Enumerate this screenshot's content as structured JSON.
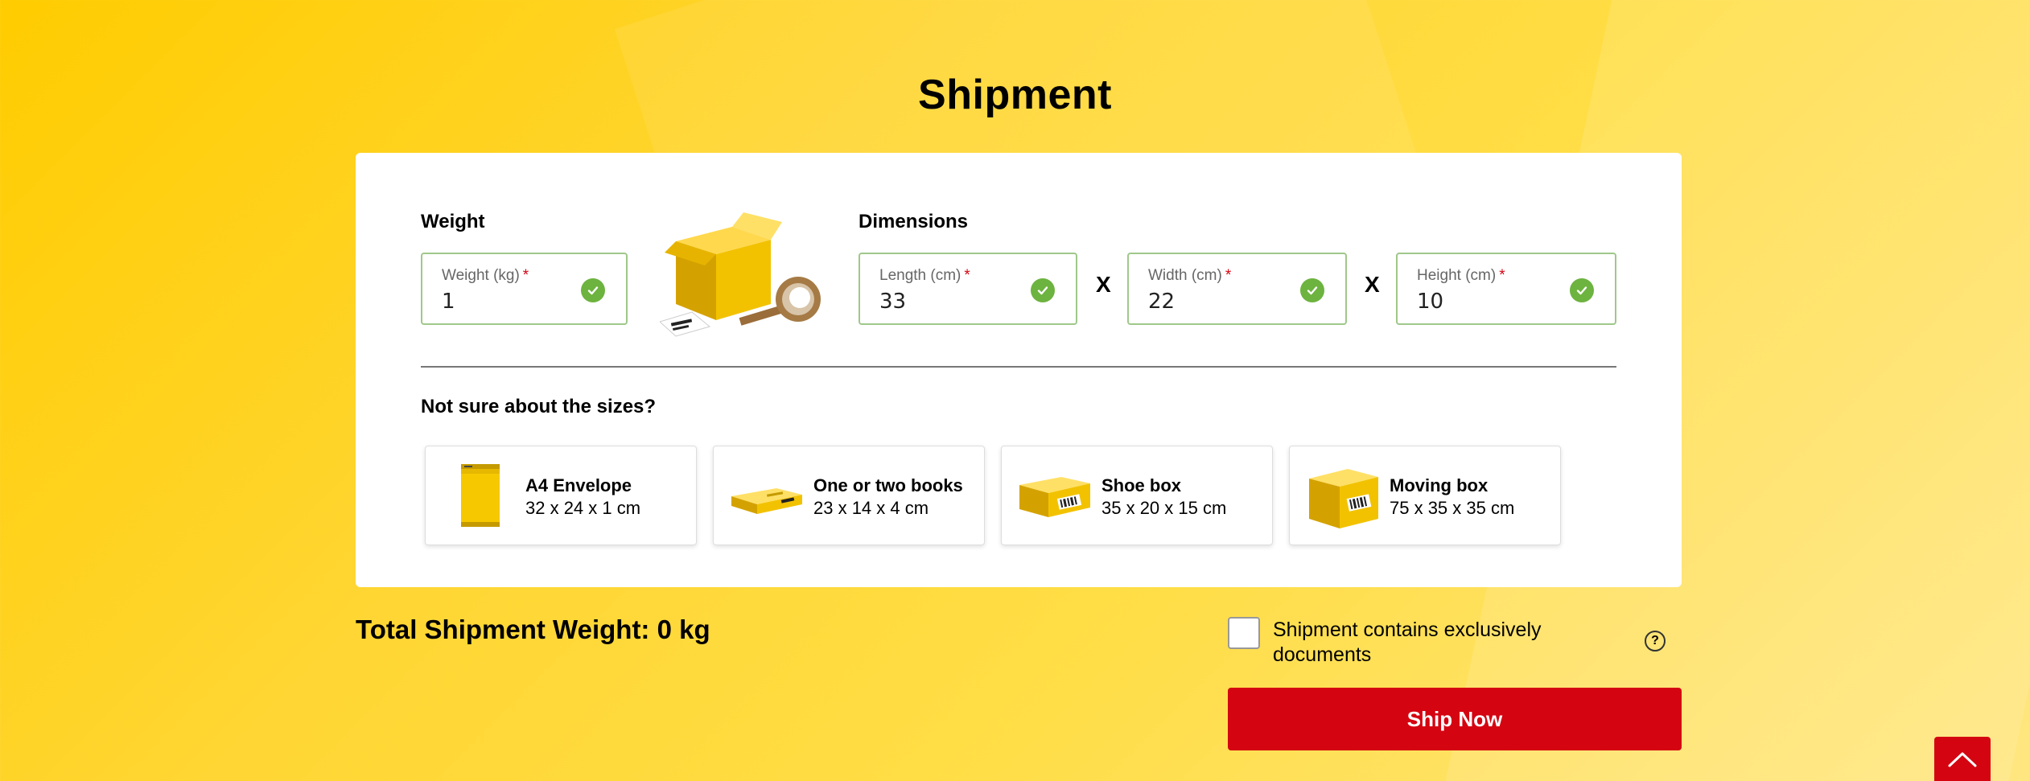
{
  "page": {
    "title": "Shipment"
  },
  "weight": {
    "section_label": "Weight",
    "field_label": "Weight (kg)",
    "required_mark": "*",
    "value": "1"
  },
  "dimensions": {
    "section_label": "Dimensions",
    "separator": "X",
    "length": {
      "label": "Length (cm)",
      "required_mark": "*",
      "value": "33"
    },
    "width": {
      "label": "Width (cm)",
      "required_mark": "*",
      "value": "22"
    },
    "height": {
      "label": "Height (cm)",
      "required_mark": "*",
      "value": "10"
    }
  },
  "suggestions": {
    "heading": "Not sure about the sizes?",
    "items": [
      {
        "title": "A4 Envelope",
        "dims": "32 x 24 x 1 cm",
        "icon": "envelope-icon"
      },
      {
        "title": "One or two books",
        "dims": "23 x 14 x 4 cm",
        "icon": "books-icon"
      },
      {
        "title": "Shoe box",
        "dims": "35 x 20 x 15 cm",
        "icon": "shoe-box-icon"
      },
      {
        "title": "Moving box",
        "dims": "75 x 35 x 35 cm",
        "icon": "moving-box-icon"
      }
    ]
  },
  "footer": {
    "total_weight": "Total Shipment Weight: 0 kg",
    "docs_label": "Shipment contains exclusively documents",
    "help_symbol": "?",
    "ship_button": "Ship Now"
  },
  "colors": {
    "brand_yellow": "#ffcc00",
    "brand_red": "#d40511",
    "valid_green": "#6db33f"
  }
}
